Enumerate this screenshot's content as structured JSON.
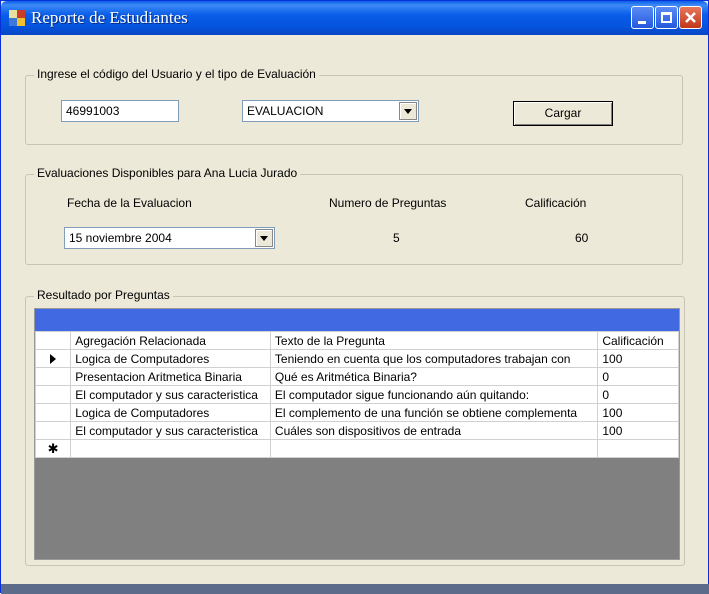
{
  "window": {
    "title": "Reporte de Estudiantes",
    "icons": {
      "app": "app-window-icon",
      "minimize": "minimize-icon",
      "maximize": "maximize-icon",
      "close": "close-icon"
    }
  },
  "group_load": {
    "legend": "Ingrese el código del Usuario y el tipo de Evaluación",
    "user_code": "46991003",
    "evaluation_type": "EVALUACION",
    "load_button": "Cargar"
  },
  "group_available": {
    "legend": "Evaluaciones Disponibles para Ana Lucia Jurado",
    "date_label": "Fecha de la Evaluacion",
    "questions_label": "Numero de Preguntas",
    "grade_label": "Calificación",
    "date_value": "15 noviembre  2004",
    "questions_value": "5",
    "grade_value": "60"
  },
  "group_results": {
    "legend": "Resultado por Preguntas",
    "columns": [
      "Agregación Relacionada",
      "Texto de la Pregunta",
      "Calificación"
    ],
    "rows": [
      {
        "area": "Logica de Computadores",
        "question": "Teniendo en cuenta que los computadores trabajan con",
        "grade": "100"
      },
      {
        "area": "Presentacion Aritmetica Binaria",
        "question": "Qué es Aritmética Binaria?",
        "grade": "0"
      },
      {
        "area": "El computador y sus caracteristica",
        "question": "El computador sigue funcionando aún quitando:",
        "grade": "0"
      },
      {
        "area": "Logica de Computadores",
        "question": "El complemento de una función se obtiene complementa",
        "grade": "100"
      },
      {
        "area": "El computador y sus caracteristica",
        "question": "Cuáles son dispositivos de entrada",
        "grade": "100"
      }
    ],
    "current_row_marker": "▶",
    "new_row_marker": "✱"
  },
  "colors": {
    "title_bar": "#0a5ee8",
    "window_bg": "#ece9d8",
    "grid_caption": "#4169e1",
    "grid_empty_area": "#808080"
  }
}
